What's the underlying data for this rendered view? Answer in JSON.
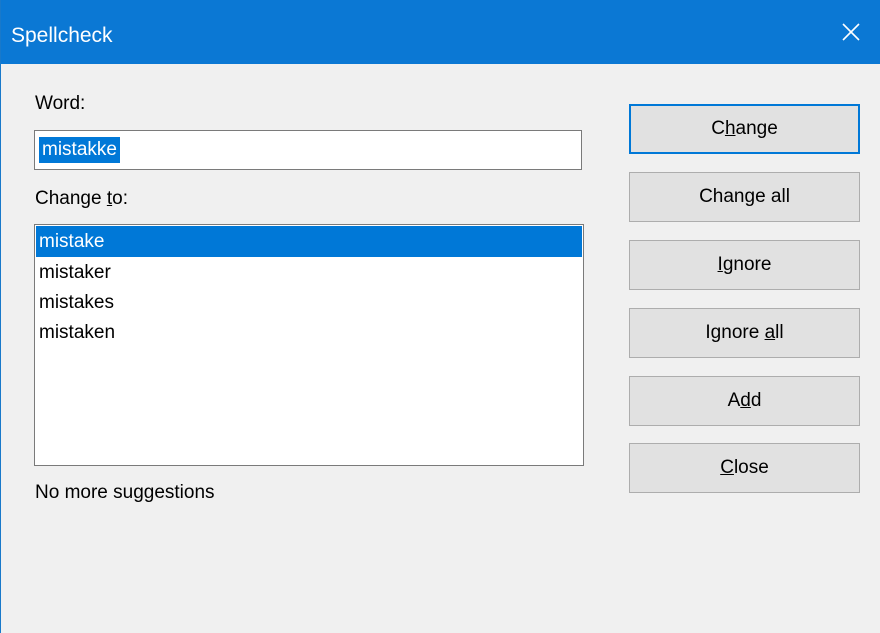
{
  "window": {
    "title": "Spellcheck"
  },
  "word": {
    "label": "Word:",
    "value": "mistakke"
  },
  "change_to": {
    "label_pre": "Change ",
    "label_accel": "t",
    "label_post": "o:",
    "suggestions": [
      "mistake",
      "mistaker",
      "mistakes",
      "mistaken"
    ],
    "selected_index": 0
  },
  "buttons": {
    "change": {
      "pre": "C",
      "accel": "h",
      "post": "ange"
    },
    "change_all": {
      "pre": "Chan",
      "accel": "g",
      "post": "e all"
    },
    "ignore": {
      "pre": "",
      "accel": "I",
      "post": "gnore"
    },
    "ignore_all": {
      "pre": "Ignore ",
      "accel": "a",
      "post": "ll"
    },
    "add": {
      "pre": "A",
      "accel": "d",
      "post": "d"
    },
    "close": {
      "pre": "",
      "accel": "C",
      "post": "lose"
    }
  },
  "status": "No more suggestions",
  "colors": {
    "titlebar": "#0b78d4",
    "selection": "#0078d7",
    "dialog_bg": "#f0f0f0",
    "button_bg": "#e1e1e1"
  }
}
